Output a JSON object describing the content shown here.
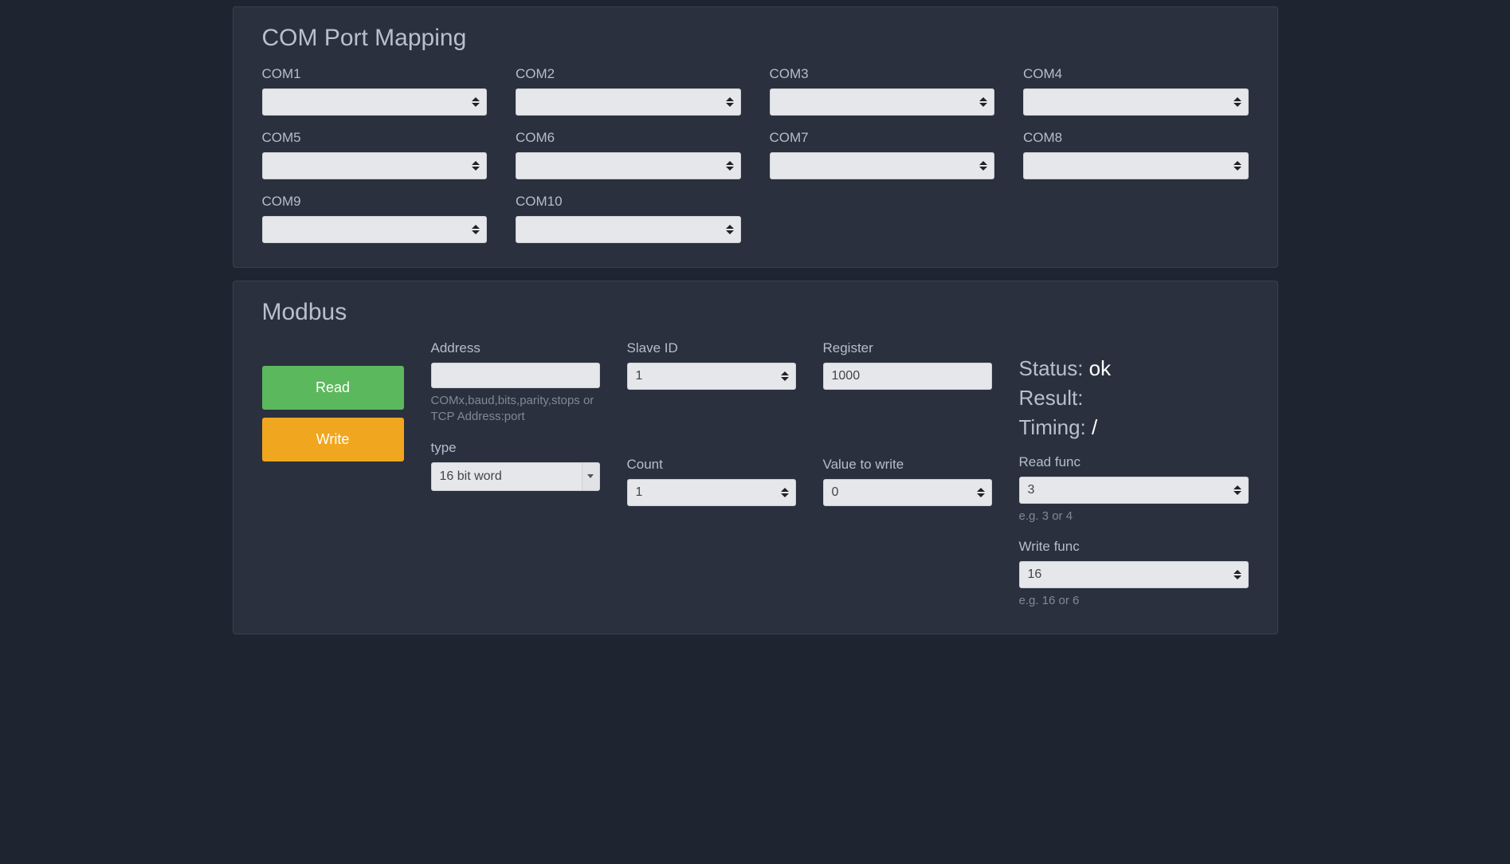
{
  "com_mapping": {
    "title": "COM Port Mapping",
    "ports": [
      {
        "label": "COM1",
        "value": ""
      },
      {
        "label": "COM2",
        "value": ""
      },
      {
        "label": "COM3",
        "value": ""
      },
      {
        "label": "COM4",
        "value": ""
      },
      {
        "label": "COM5",
        "value": ""
      },
      {
        "label": "COM6",
        "value": ""
      },
      {
        "label": "COM7",
        "value": ""
      },
      {
        "label": "COM8",
        "value": ""
      },
      {
        "label": "COM9",
        "value": ""
      },
      {
        "label": "COM10",
        "value": ""
      }
    ]
  },
  "modbus": {
    "title": "Modbus",
    "read_label": "Read",
    "write_label": "Write",
    "address_label": "Address",
    "address_value": "",
    "address_help": "COMx,baud,bits,parity,stops or TCP Address:port",
    "slave_label": "Slave ID",
    "slave_value": "1",
    "register_label": "Register",
    "register_value": "1000",
    "type_label": "type",
    "type_value": "16 bit word",
    "count_label": "Count",
    "count_value": "1",
    "valwrite_label": "Value to write",
    "valwrite_value": "0",
    "status_label": "Status: ",
    "status_value": "ok",
    "result_label": "Result:",
    "result_value": "",
    "timing_label": "Timing: ",
    "timing_value": "/",
    "readfunc_label": "Read func",
    "readfunc_value": "3",
    "readfunc_help": "e.g. 3 or 4",
    "writefunc_label": "Write func",
    "writefunc_value": "16",
    "writefunc_help": "e.g. 16 or 6"
  }
}
